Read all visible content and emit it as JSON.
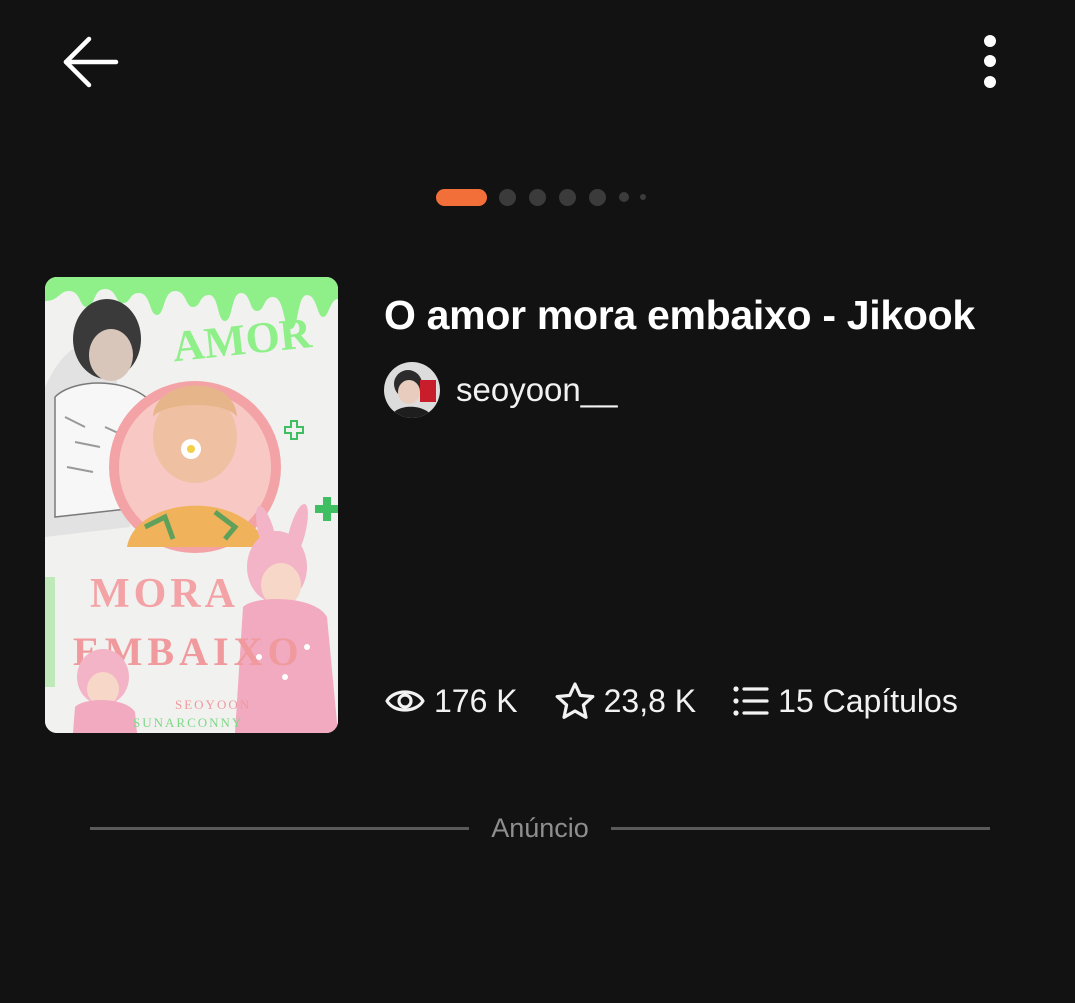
{
  "header": {
    "back_icon": "arrow-left-icon",
    "more_icon": "more-vertical-icon"
  },
  "pager": {
    "count": 7,
    "active_index": 0,
    "accent": "#f26f3a"
  },
  "story": {
    "title": "O amor mora embaixo - Jikook",
    "author": "seoyoon__",
    "cover": {
      "line1": "AMOR",
      "line2": "MORA",
      "line3": "EMBAIXO",
      "credit1": "SEOYOON",
      "credit2": "SUNARCONNY"
    },
    "stats": {
      "views": "176 K",
      "votes": "23,8 K",
      "chapters": "15 Capítulos"
    }
  },
  "ad": {
    "label": "Anúncio"
  },
  "colors": {
    "background": "#121212",
    "text": "#ffffff",
    "muted": "#8e8e8e",
    "cover_green": "#8ff08a",
    "cover_pink": "#f3a3a6"
  }
}
